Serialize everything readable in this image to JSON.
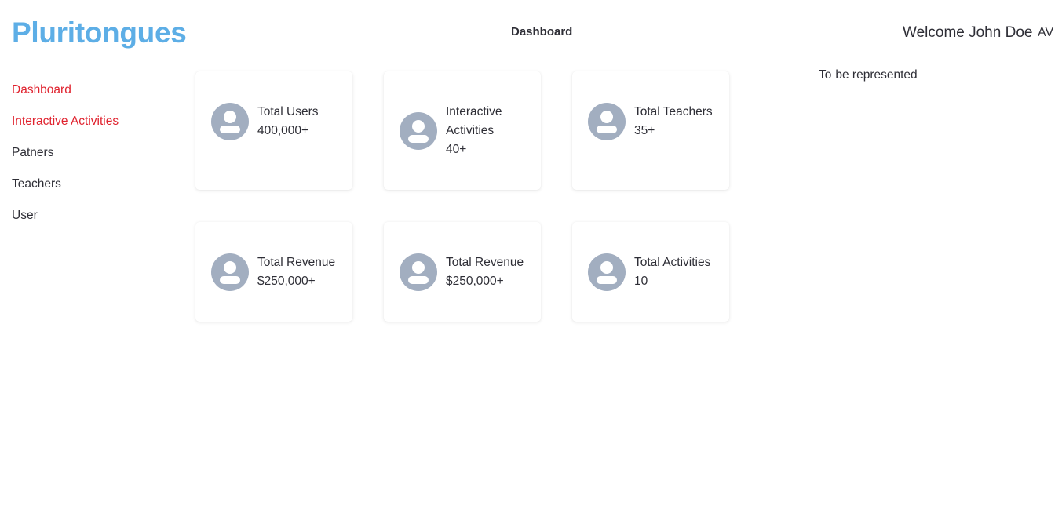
{
  "header": {
    "logo": "Pluritongues",
    "nav_title": "Dashboard",
    "welcome": "Welcome John Doe",
    "initials": "AV"
  },
  "sidebar": {
    "items": [
      {
        "label": "Dashboard",
        "active": true
      },
      {
        "label": "Interactive Activities",
        "active": true
      },
      {
        "label": "Patners",
        "active": false
      },
      {
        "label": "Teachers",
        "active": false
      },
      {
        "label": "User",
        "active": false
      }
    ]
  },
  "stats": {
    "cards": [
      {
        "label": "Total Users",
        "value": "400,000+",
        "icon": "user-avatar-icon"
      },
      {
        "label": "Interactive Activities",
        "value": "40+",
        "icon": "user-avatar-icon"
      },
      {
        "label": "Total Teachers",
        "value": "35+",
        "icon": "user-avatar-icon"
      },
      {
        "label": "Total Revenue",
        "value": "$250,000+",
        "icon": "user-avatar-icon"
      },
      {
        "label": "Total Revenue",
        "value": "$250,000+",
        "icon": "user-avatar-icon"
      },
      {
        "label": "Total Activities",
        "value": "10",
        "icon": "user-avatar-icon"
      }
    ]
  },
  "note": {
    "before_caret": "To",
    "after_caret": "be represented"
  },
  "colors": {
    "brand": "#5daee6",
    "active_link": "#e0232f",
    "avatar": "#a2aec0",
    "text": "#2e2e36"
  }
}
